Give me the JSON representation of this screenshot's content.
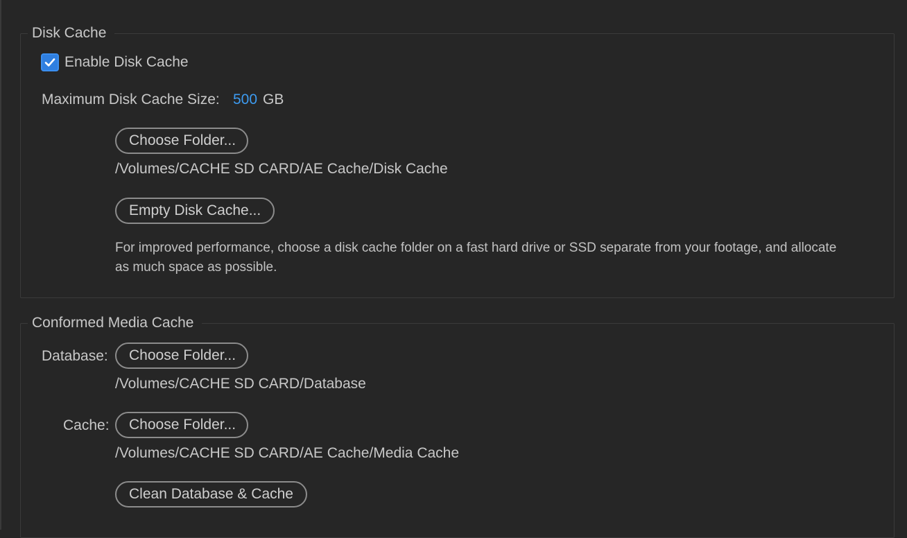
{
  "disk_cache": {
    "title": "Disk Cache",
    "enable_label": "Enable Disk Cache",
    "enable_checked": true,
    "max_size_label": "Maximum Disk Cache Size:",
    "max_size_value": "500",
    "max_size_unit": "GB",
    "choose_folder_label": "Choose Folder...",
    "folder_path": "/Volumes/CACHE SD CARD/AE Cache/Disk Cache",
    "empty_button_label": "Empty Disk Cache...",
    "hint": "For improved performance, choose a disk cache folder on a fast hard drive or SSD separate from your footage, and allocate as much space as possible."
  },
  "conformed_media_cache": {
    "title": "Conformed Media Cache",
    "database_label": "Database:",
    "database_button_label": "Choose Folder...",
    "database_path": "/Volumes/CACHE SD CARD/Database",
    "cache_label": "Cache:",
    "cache_button_label": "Choose Folder...",
    "cache_path": "/Volumes/CACHE SD CARD/AE Cache/Media Cache",
    "clean_button_label": "Clean Database & Cache"
  },
  "colors": {
    "background": "#262626",
    "accent": "#2f7fe0",
    "value_blue": "#3d9bf0",
    "button_border": "#8c8c8c"
  },
  "icons": {
    "checkbox": "checkmark-icon"
  }
}
